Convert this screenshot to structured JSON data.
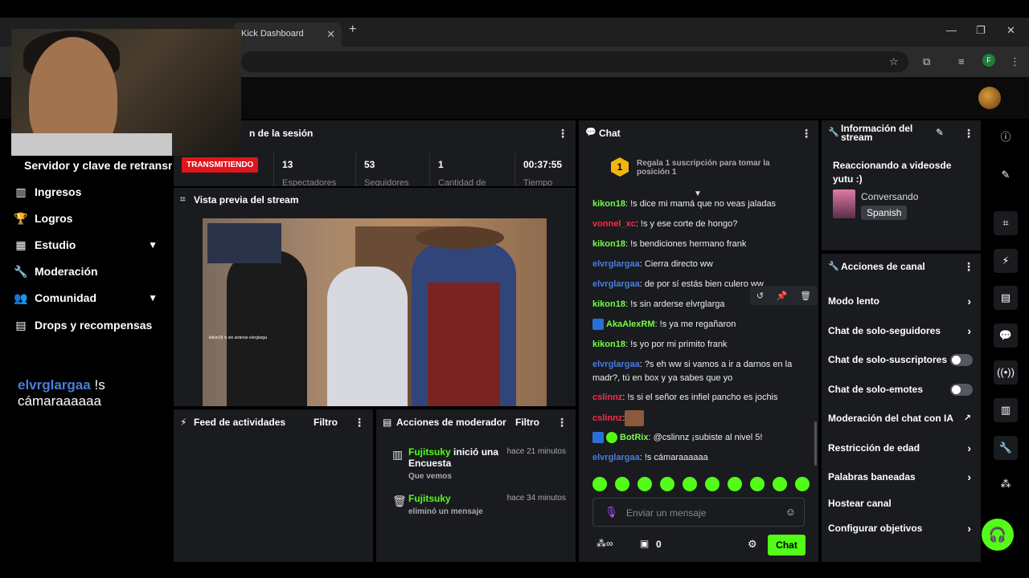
{
  "browser": {
    "tab_title": "Kick Dashboard",
    "profile_letter": "F"
  },
  "colors": {
    "accent": "#53fc18",
    "live": "#e0141c",
    "panel": "#191b1f"
  },
  "sidebar": {
    "section_title": "Servidor y clave de retransmisión",
    "items": [
      {
        "label": "Ingresos",
        "icon": "income-icon"
      },
      {
        "label": "Logros",
        "icon": "trophy-icon"
      },
      {
        "label": "Estudio",
        "icon": "studio-icon"
      },
      {
        "label": "Moderación",
        "icon": "wrench-icon"
      },
      {
        "label": "Comunidad",
        "icon": "community-icon"
      },
      {
        "label": "Drops y recompensas",
        "icon": "drops-icon"
      }
    ],
    "overlay_message": {
      "user": "elvrglargaa",
      "text": "!s cámaraaaaaa"
    }
  },
  "session": {
    "title": "n de la sesión",
    "status": "TRANSMITIENDO",
    "stats": [
      {
        "value": "13",
        "label": "Espectadores"
      },
      {
        "value": "53",
        "label": "Seguidores"
      },
      {
        "value": "1",
        "label": "Cantidad de"
      },
      {
        "value": "00:37:55",
        "label": "Tiempo"
      }
    ]
  },
  "preview": {
    "title": "Vista previa del stream",
    "caption": "kikon18 !s sin arderse elvrglarga"
  },
  "feed": {
    "title": "Feed de actividades",
    "filter": "Filtro"
  },
  "mod_actions": {
    "title": "Acciones de moderador",
    "filter": "Filtro",
    "entries": [
      {
        "user": "Fujitsuky",
        "action": "inició una Encuesta",
        "sub": "Que vemos",
        "time": "hace 21 minutos"
      },
      {
        "user": "Fujitsuky",
        "action": "",
        "sub": "eliminó un mensaje",
        "time": "hace 34 minutos"
      }
    ]
  },
  "chat": {
    "title": "Chat",
    "gift_badge": "1",
    "gift_text": "Regala 1 suscripción para tomar la posición 1",
    "messages": [
      {
        "user": "kikon18",
        "color": "#75fd46",
        "text": ": !s dice mi mamá que no veas jaladas"
      },
      {
        "user": "vonnel_xc",
        "color": "#ff2a4a",
        "text": ": !s y ese corte de hongo?"
      },
      {
        "user": "kikon18",
        "color": "#75fd46",
        "text": ": !s bendiciones hermano frank"
      },
      {
        "user": "elvrglargaa",
        "color": "#4a7ddd",
        "text": ": Cierra directo ww"
      },
      {
        "user": "elvrglargaa",
        "color": "#4a7ddd",
        "text": ": de por sí estás bien culero ww"
      },
      {
        "user": "kikon18",
        "color": "#75fd46",
        "text": ": !s sin arderse elvrglarga"
      },
      {
        "user": "AkaAlexRM",
        "color": "#75fd46",
        "text": ": !s ya me regañaron"
      },
      {
        "user": "kikon18",
        "color": "#75fd46",
        "text": ": !s yo por mi primito frank"
      },
      {
        "user": "elvrglargaa",
        "color": "#4a7ddd",
        "text": ": ?s eh ww si vamos a ir a darnos en la madr?, tú en box y ya sabes que yo"
      },
      {
        "user": "cslinnz",
        "color": "#ff2a4a",
        "text": ": !s si el señor es infiel pancho es jochis"
      },
      {
        "user": "cslinnz",
        "color": "#ff2a4a",
        "text": ":"
      },
      {
        "user": "BotRix",
        "color": "#75fd46",
        "text": ": @cslinnz ¡subiste al nivel 5!"
      },
      {
        "user": "elvrglargaa",
        "color": "#4a7ddd",
        "text": ": !s cámaraaaaaa"
      }
    ],
    "input_placeholder": "Enviar un mensaje",
    "points": "0",
    "send_label": "Chat"
  },
  "stream_info": {
    "title": "Información del stream",
    "stream_title": "Reaccionando a videosde yutu :)",
    "category": "Conversando",
    "language": "Spanish"
  },
  "channel_actions": {
    "title": "Acciones de canal",
    "items": [
      {
        "label": "Modo lento",
        "control": "arrow"
      },
      {
        "label": "Chat de solo-seguidores",
        "control": "arrow"
      },
      {
        "label": "Chat de solo-suscriptores",
        "control": "toggle",
        "enabled": false
      },
      {
        "label": "Chat de solo-emotes",
        "control": "toggle",
        "enabled": false
      },
      {
        "label": "Moderación del chat con IA",
        "control": "external"
      },
      {
        "label": "Restricción de edad",
        "control": "arrow"
      },
      {
        "label": "Palabras baneadas",
        "control": "arrow"
      },
      {
        "label": "Hostear canal",
        "control": "none"
      },
      {
        "label": "Configurar objetivos",
        "control": "arrow"
      }
    ]
  },
  "rail": [
    "info-icon",
    "edit-icon",
    "capture-icon",
    "bolt-icon",
    "notes-icon",
    "chat-icon",
    "broadcast-icon",
    "layout-icon",
    "wrench-icon",
    "community-icon"
  ]
}
